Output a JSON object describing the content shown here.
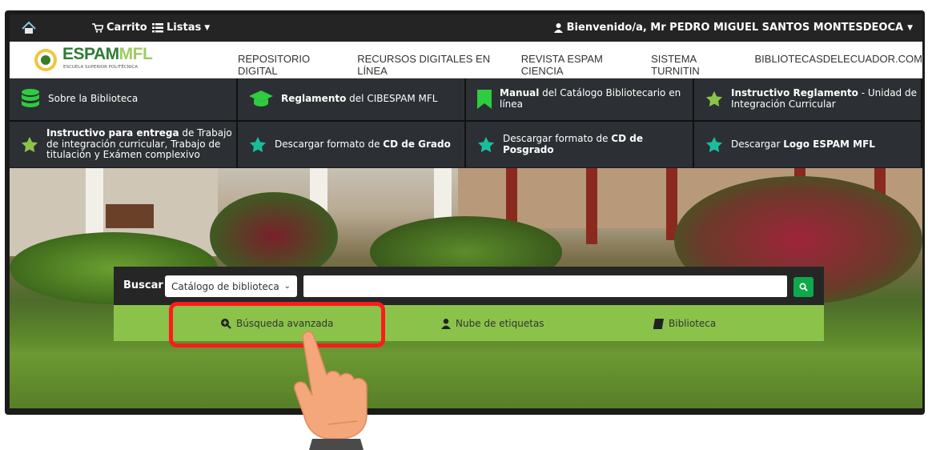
{
  "topbar": {
    "cart_label": "Carrito",
    "lists_label": "Listas",
    "welcome_label": "Bienvenido/a, Mr PEDRO MIGUEL SANTOS MONTESDEOCA"
  },
  "logo": {
    "text_dark": "ESPAM",
    "text_accent": "MFL",
    "subtitle": "ESCUELA SUPERIOR POLITÉCNICA"
  },
  "nav": {
    "links": [
      "REPOSITORIO DIGITAL",
      "RECURSOS DIGITALES EN LÍNEA",
      "REVISTA ESPAM CIENCIA",
      "SISTEMA TURNITIN",
      "BIBLIOTECASDELECUADOR.COM"
    ]
  },
  "tiles": [
    {
      "bold": "",
      "rest": "Sobre la Biblioteca",
      "icon": "database-icon"
    },
    {
      "bold": "Reglamento",
      "rest": " del CIBESPAM MFL",
      "icon": "graduation-cap-icon"
    },
    {
      "bold": "Manual",
      "rest": " del Catálogo Bibliotecario en línea",
      "icon": "bookmark-icon"
    },
    {
      "bold": "Instructivo Reglamento",
      "rest": " - Unidad de Integración Curricular",
      "icon": "star-icon"
    },
    {
      "bold": "Instructivo para entrega",
      "rest": " de Trabajo de integración curricular, Trabajo de titulación y Exámen complexivo",
      "icon": "star-icon"
    },
    {
      "bold_pre": "Descargar formato de ",
      "bold": "CD de Grado",
      "rest": "",
      "icon": "star-icon"
    },
    {
      "bold_pre": "Descargar formato de ",
      "bold": "CD de Posgrado",
      "rest": "",
      "icon": "star-icon"
    },
    {
      "bold_pre": "Descargar ",
      "bold": "Logo ESPAM MFL",
      "rest": "",
      "icon": "star-icon"
    }
  ],
  "search": {
    "label": "Buscar",
    "selected_option": "Catálogo de biblioteca",
    "input_value": "",
    "button_icon": "search-icon"
  },
  "links_bar": {
    "advanced": "Búsqueda avanzada",
    "tags": "Nube de etiquetas",
    "library": "Biblioteca"
  },
  "colors": {
    "accent_green": "#8bc34a",
    "button_green": "#0fa84a",
    "tile_bg": "#2c2f33",
    "highlight": "#ff1a1a"
  }
}
